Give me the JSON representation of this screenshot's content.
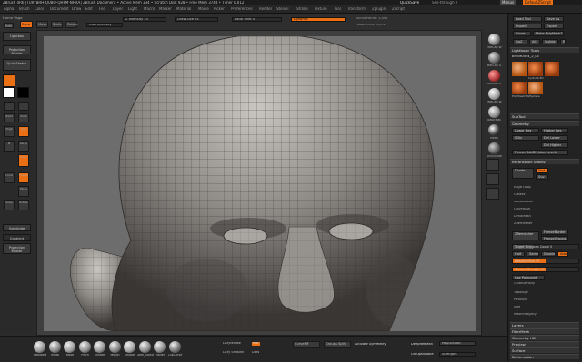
{
  "titlebar": {
    "text": "ZBrush 4R6 [TURYBRH-QUBO-QHYM-NHXA]   ZBrush Document   • Active Mem 334 • Scratch Disk 928 • Free Mem 3744 • Timer 0.012",
    "quicksave": "QuickSave",
    "seethrough": "See-through 0",
    "menus": "Menus",
    "defaultzscript": "DefaultZScript"
  },
  "menubar": [
    "Alpha",
    "Brush",
    "Color",
    "Document",
    "Draw",
    "Edit",
    "File",
    "Layer",
    "Light",
    "Macro",
    "Marker",
    "Material",
    "Movie",
    "Picker",
    "Preferences",
    "Render",
    "Stencil",
    "Stroke",
    "Texture",
    "Tool",
    "Transform",
    "Zplugin",
    "Zscript"
  ],
  "topctrl": {
    "home_label": "Home Page",
    "mode_buttons": [
      "Edit",
      "Draw",
      "Move",
      "Scale",
      "Rotate"
    ],
    "active_mode": "Draw",
    "rgb_intensity": "RGB Intensity",
    "z_intensity": "Z Intensity 25",
    "draw_size": "Draw Size 64",
    "focal_shift": "Focal Shift 0",
    "dynamic": "Dynamic",
    "active_points": "ActivePoints: 3,092",
    "total_points": "TotalPoints: 3,092"
  },
  "leftshelf": {
    "buttons": [
      "Lightbox",
      "Projection Master",
      "QuickSketch"
    ],
    "icon_labels": [
      "Zadd",
      "Zsub",
      "Mrgb",
      "Rgb",
      "M",
      "Persp",
      "Floor",
      "Local",
      "Frame",
      "Move",
      "Scale",
      "Rotate"
    ],
    "bottom_buttons": [
      "Subdivide",
      "Gradient",
      "Projection Master"
    ]
  },
  "matcol": {
    "labels": [
      "MatCap W",
      "MatCap G",
      "MatCap R",
      "MatCap W",
      "BasicMat",
      "Metal",
      "SkinShade",
      "Chalk",
      "ReflectedMap"
    ]
  },
  "tray": {
    "top_buttons": [
      "Load Tool",
      "Save As",
      "Import",
      "Export",
      "Clone",
      "Make PolyMesh3D",
      "GoZ",
      "All",
      "Visible",
      "R"
    ],
    "lightbox_tools": "Lightbox> Tools",
    "tool_name": "Bruce0044_2_L3",
    "thumbs": [
      "Cylinder3D",
      "SimpleBrush",
      "PolyMesh3D",
      "ZSphere"
    ],
    "sections": [
      "SubTool",
      "Geometry",
      "Lower Res",
      "Higher Res",
      "Reconstruct Subdiv",
      "Divide",
      "Smt",
      "Suv",
      "Edge Loop",
      "Crease",
      "ShadowBox",
      "ClayPolish",
      "DynaMesh",
      "ZRemesher",
      "Topology",
      "Position",
      "Size",
      "MeshIntegrity",
      "Layers",
      "FiberMesh",
      "Geometry HD",
      "Preview",
      "Surface",
      "Deformation",
      "Masking"
    ],
    "zremesher_btn": "ZRemesher",
    "freeze_border": "FreezeBorder",
    "freeze_groups": "FreezeGroups",
    "target_poly": "Target Polygons Count 5",
    "half": "Half",
    "same": "Same",
    "double": "Double",
    "adapt": "Adapt",
    "adaptive_size": "AdaptiveSize 50",
    "curves_strength": "Curves Strength 50",
    "use_polypaint": "Use Polypaint",
    "color_density": "ColorDensity",
    "sdiv": "SDiv",
    "del_lower": "Del Lower",
    "del_higher": "Del Higher",
    "freeze_subdiv": "Freeze SubDivision Levels",
    "modify_topology": "Modify Topology"
  },
  "bottom": {
    "brushes": [
      "Standard",
      "InFlat",
      "Move",
      "Pinch",
      "Inflate",
      "Morph",
      "Smooth",
      "Dam_Standard",
      "Mallet",
      "ClipCurve"
    ],
    "lazymouse": "LazyMouse",
    "lazy_step": "Lazy Step",
    "lazy_smooth": "Lazy Smooth",
    "roll": "Roll",
    "dots": "Dots",
    "color_rect": "Colorize",
    "curve_mode": "CurveMF",
    "dynamic": "Dynamic",
    "groups_split": "Groups Split",
    "activate_symmetry": "Activate Symmetry",
    "deformation_label": "DeepRemesh",
    "polishpatch": "PolyGroupIt",
    "group_visible": "GroupsVisible",
    "strength": "Strength"
  },
  "colors": {
    "accent": "#ea6f15",
    "panel": "#2b2b2b",
    "canvas": "#6b6b6b",
    "skin": "#8e8a86"
  }
}
